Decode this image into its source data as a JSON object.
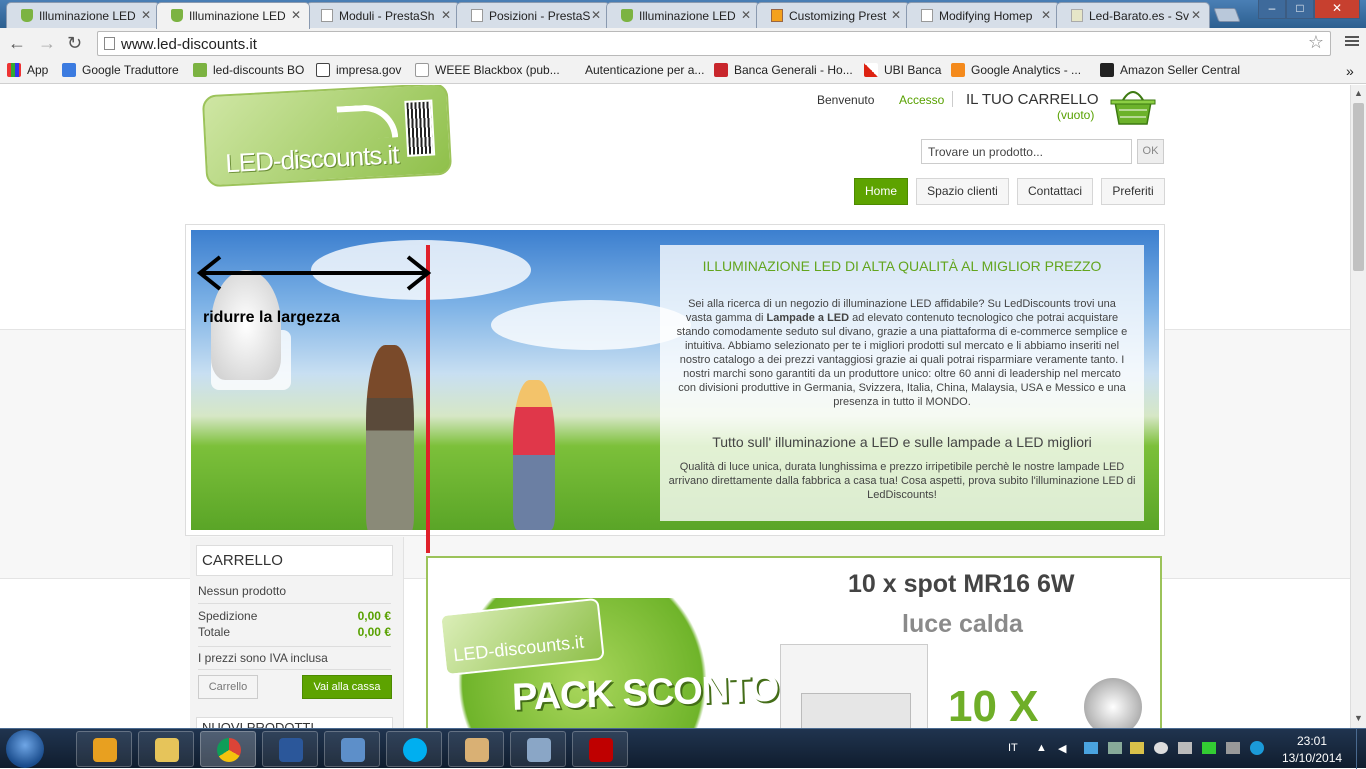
{
  "browser": {
    "tabs": [
      {
        "title": "Illuminazione LED",
        "fav": "g"
      },
      {
        "title": "Illuminazione LED",
        "fav": "g"
      },
      {
        "title": "Moduli - PrestaSh",
        "fav": "p"
      },
      {
        "title": "Posizioni - PrestaS",
        "fav": "p"
      },
      {
        "title": "Illuminazione LED",
        "fav": "g"
      },
      {
        "title": "Customizing Prest",
        "fav": "o"
      },
      {
        "title": "Modifying Homep",
        "fav": "p"
      },
      {
        "title": "Led-Barato.es - Sv",
        "fav": "l"
      }
    ],
    "active_tab": 1,
    "url": "www.led-discounts.it",
    "bookmarks": [
      "App",
      "Google Traduttore",
      "led-discounts BO",
      "impresa.gov",
      "WEEE Blackbox (pub...",
      "Autenticazione per a...",
      "Banca Generali - Ho...",
      "UBI Banca",
      "Google Analytics - ...",
      "Amazon Seller Central"
    ],
    "window_controls": {
      "minimize": "–",
      "maximize": "□",
      "close": "✕"
    }
  },
  "header": {
    "logo_text": "LED-discounts.it",
    "welcome": "Benvenuto",
    "login": "Accesso",
    "cart_title": "IL TUO CARRELLO",
    "cart_status": "(vuoto)",
    "search_placeholder": "Trovare un prodotto...",
    "search_button": "OK",
    "nav": [
      "Home",
      "Spazio clienti",
      "Contattaci",
      "Preferiti"
    ]
  },
  "slider": {
    "title": "ILLUMINAZIONE LED DI ALTA QUALITÀ AL MIGLIOR PREZZO",
    "body_before": "Sei alla ricerca di un negozio di illuminazione LED affidabile? Su LedDiscounts trovi una vasta gamma di ",
    "body_bold": "Lampade a LED",
    "body_after": " ad elevato contenuto tecnologico che potrai acquistare stando comodamente seduto sul divano, grazie a una piattaforma di e-commerce semplice e intuitiva. Abbiamo selezionato per te i migliori prodotti sul mercato e li abbiamo inseriti nel nostro catalogo a dei prezzi vantaggiosi grazie ai quali potrai risparmiare veramente tanto. I nostri marchi sono garantiti da un produttore unico: oltre 60 anni di leadership nel mercato con divisioni produttive in Germania, Svizzera, Italia, China, Malaysia, USA e Messico e una presenza in tutto il MONDO.",
    "subtitle": "Tutto sull' illuminazione a LED e sulle lampade a LED migliori",
    "body2": "Qualità di luce unica, durata lunghissima e prezzo irripetibile perchè le nostre lampade LED arrivano direttamente dalla fabbrica a casa tua! Cosa aspetti, prova subito l'illuminazione LED di LedDiscounts!"
  },
  "annotation": {
    "text": "ridurre la largezza",
    "color": "#e0202a"
  },
  "cart": {
    "title": "CARRELLO",
    "empty": "Nessun prodotto",
    "shipping_label": "Spedizione",
    "shipping_value": "0,00 €",
    "total_label": "Totale",
    "total_value": "0,00 €",
    "vat_note": "I prezzi sono IVA inclusa",
    "cart_button": "Carrello",
    "checkout_button": "Vai alla cassa",
    "next_block": "NUOVI PRODOTTI"
  },
  "promo": {
    "logo_text": "LED-discounts.it",
    "pack": "PACK SCONTO!",
    "line1": "10 x spot MR16 6W",
    "line2": "luce calda",
    "big": "10 X"
  },
  "taskbar": {
    "apps": [
      "media-player",
      "explorer",
      "chrome",
      "word",
      "photo-viewer",
      "skype",
      "paint",
      "remote-desktop",
      "filezilla"
    ],
    "lang": "IT",
    "time": "23:01",
    "date": "13/10/2014"
  },
  "colors": {
    "brand_green": "#5da300",
    "accent_green": "#63a51e",
    "annotation_red": "#e0202a"
  }
}
